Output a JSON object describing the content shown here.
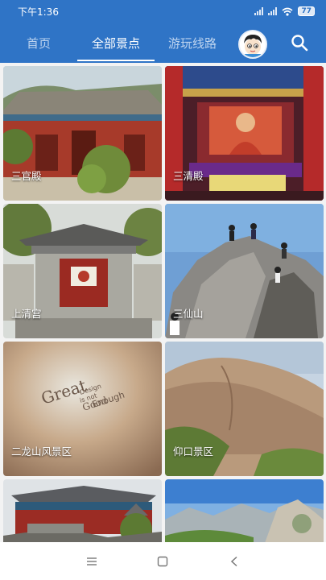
{
  "status_bar": {
    "time": "下午1:36",
    "battery": "77"
  },
  "tabs": [
    {
      "label": "首页",
      "active": false
    },
    {
      "label": "全部景点",
      "active": true
    },
    {
      "label": "游玩线路",
      "active": false
    }
  ],
  "colors": {
    "header": "#2f74c6",
    "tab_inactive": "#bcd3ef"
  },
  "icons": {
    "avatar": "cartoon-boy-avatar",
    "search": "search-icon",
    "menu": "menu-icon",
    "home": "square-icon",
    "back": "back-icon"
  },
  "attractions": [
    {
      "name": "三官殿"
    },
    {
      "name": "三清殿"
    },
    {
      "name": "上清宫"
    },
    {
      "name": "三仙山"
    },
    {
      "name": "二龙山风景区"
    },
    {
      "name": "仰口景区"
    },
    {
      "name": ""
    },
    {
      "name": ""
    }
  ],
  "watermark": {
    "line1": "Great",
    "line2": "Design",
    "line3": "is not",
    "line4": "Good",
    "line5": "Enough"
  }
}
